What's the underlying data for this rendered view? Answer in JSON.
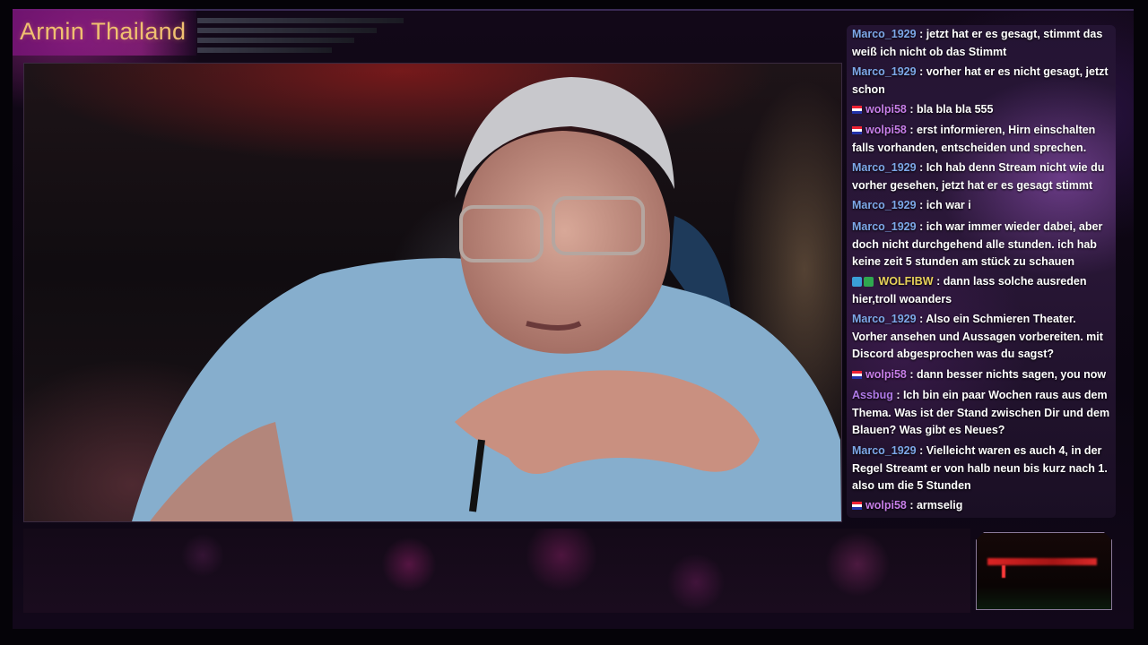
{
  "channel": {
    "title": "Armin Thailand"
  },
  "chat": {
    "messages": [
      {
        "user": "Marco_1929",
        "color": "#7da8e8",
        "badge": "",
        "text": ": jetzt hat er es gesagt, stimmt das weiß ich nicht ob das Stimmt"
      },
      {
        "user": "Marco_1929",
        "color": "#7da8e8",
        "badge": "",
        "text": ": vorher hat er es nicht gesagt, jetzt schon"
      },
      {
        "user": "wolpi58",
        "color": "#c77ee8",
        "badge": "flag",
        "text": ": bla bla bla 555"
      },
      {
        "user": "wolpi58",
        "color": "#c77ee8",
        "badge": "flag",
        "text": ": erst informieren, Hirn einschalten falls vorhanden, entscheiden und sprechen."
      },
      {
        "user": "Marco_1929",
        "color": "#7da8e8",
        "badge": "",
        "text": ": Ich hab denn Stream nicht wie du vorher gesehen, jetzt hat er es gesagt stimmt"
      },
      {
        "user": "Marco_1929",
        "color": "#7da8e8",
        "badge": "",
        "text": ": ich war i"
      },
      {
        "user": "Marco_1929",
        "color": "#7da8e8",
        "badge": "",
        "text": ": ich war immer wieder dabei, aber doch nicht durchgehend alle stunden. ich hab keine zeit 5 stunden am stück zu schauen"
      },
      {
        "user": "WOLFIBW",
        "color": "#e8d25a",
        "badge": "mod",
        "text": ": dann lass solche ausreden hier,troll woanders"
      },
      {
        "user": "Marco_1929",
        "color": "#7da8e8",
        "badge": "",
        "text": ": Also ein Schmieren Theater. Vorher ansehen und Aussagen vorbereiten. mit Discord abgesprochen was du sagst?"
      },
      {
        "user": "wolpi58",
        "color": "#c77ee8",
        "badge": "flag",
        "text": ": dann besser nichts sagen, you now"
      },
      {
        "user": "Assbug",
        "color": "#b07ae8",
        "badge": "",
        "text": ": Ich bin ein paar Wochen raus aus dem Thema. Was ist der Stand zwischen Dir und dem Blauen? Was gibt es Neues?"
      },
      {
        "user": "Marco_1929",
        "color": "#7da8e8",
        "badge": "",
        "text": ": Vielleicht waren es auch 4, in der Regel Streamt er von halb neun bis kurz nach 1. also um die 5 Stunden"
      },
      {
        "user": "wolpi58",
        "color": "#c77ee8",
        "badge": "flag",
        "text": ": armselig"
      }
    ]
  }
}
